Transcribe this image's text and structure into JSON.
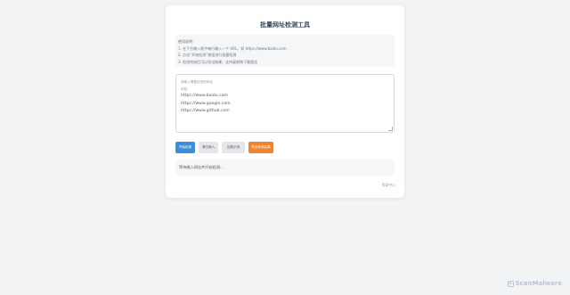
{
  "card": {
    "title": "批量网址检测工具"
  },
  "instructions": {
    "heading": "使用说明：",
    "steps": [
      "1. 在下方输入框中每行输入一个 URL，如 https://www.baidu.com",
      "2. 点击“开始检测”按钮进行批量检测",
      "3. 检测完成后可以导出结果，支持复制和下载报告"
    ]
  },
  "textarea": {
    "placeholder_line1": "请输入需要检测的网址",
    "placeholder_line2": "例如：",
    "urls": [
      "https://www.baidu.com",
      "https://www.google.com",
      "https://www.github.com"
    ]
  },
  "buttons": {
    "start": "开始检测",
    "clear": "清空输入",
    "example": "加载示例",
    "export": "导出检测结果"
  },
  "status": {
    "text": "等待输入网址并开始检测..."
  },
  "footer": {
    "link": "帮助中心"
  },
  "watermark": {
    "logo_char": "S",
    "text": "ScanMalware"
  },
  "colors": {
    "primary": "#3b8fd6",
    "orange": "#ec8430",
    "background": "#f2f3f5"
  }
}
